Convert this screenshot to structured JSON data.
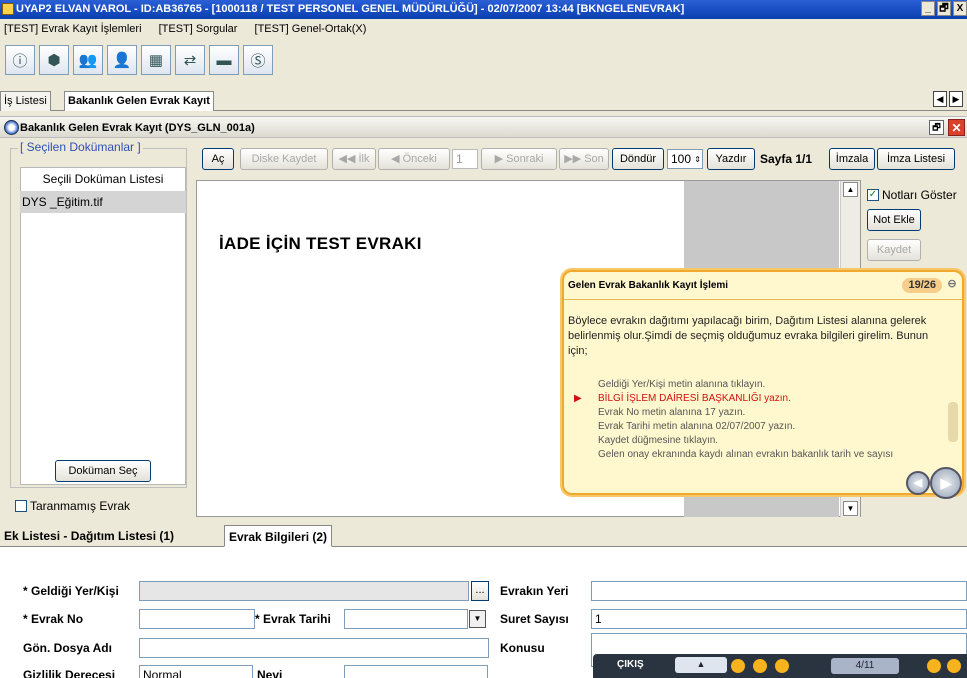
{
  "window": {
    "title": "UYAP2  ELVAN VAROL - ID:AB36765 - [1000118 / TEST PERSONEL GENEL MÜDÜRLÜĞÜ] - 02/07/2007 13:44 [BKNGELENEVRAK]",
    "controls": [
      "_",
      "🗗",
      "X"
    ]
  },
  "menu": [
    "[TEST] Evrak Kayıt İşlemleri",
    "[TEST] Sorgular",
    "[TEST] Genel-Ortak(X)"
  ],
  "tabs": [
    "İş Listesi",
    "Bakanlık Gelen Evrak Kayıt"
  ],
  "form_title": "Bakanlık Gelen Evrak Kayıt (DYS_GLN_001a)",
  "left_panel": {
    "group_title": "[ Seçilen Dokümanlar ]",
    "list_header": "Seçili Doküman Listesi",
    "items": [
      "DYS _Eğitim.tif"
    ],
    "select_button": "Doküman Seç",
    "unscanned_label": "Taranmamış Evrak"
  },
  "viewer_toolbar": {
    "open": "Aç",
    "save_disk": "Diske Kaydet",
    "first": "İlk",
    "prev": "Önceki",
    "page_input": "1",
    "next": "Sonraki",
    "last": "Son",
    "rotate": "Döndür",
    "zoom": "100",
    "print": "Yazdır",
    "page_info": "Sayfa 1/1",
    "sign": "İmzala",
    "sign_list": "İmza Listesi"
  },
  "document": {
    "text": "İADE İÇİN TEST EVRAKI"
  },
  "notes": {
    "show_label": "Notları Göster",
    "add_button": "Not Ekle",
    "save_button": "Kaydet"
  },
  "guide_popup": {
    "title": "Gelen Evrak Bakanlık Kayıt İşlemi",
    "counter": "19/26",
    "body": "Böylece evrakın dağıtımı yapılacağı birim, Dağıtım Listesi alanına gelerek belirlenmiş olur.Şimdi de seçmiş olduğumuz evraka bilgileri girelim. Bunun için;",
    "steps": [
      "Geldiği Yer/Kişi metin alanına tıklayın.",
      "BİLGİ İŞLEM DAİRESİ BAŞKANLIĞI yazın.",
      "Evrak No metin alanına 17 yazın.",
      "Evrak Tarihi metin alanına 02/07/2007 yazın.",
      "Kaydet düğmesine tıklayın.",
      "Gelen onay ekranında kaydı alınan evrakın bakanlık tarih ve sayısı"
    ],
    "current_step": 1
  },
  "bottom_tabs": [
    "Ek Listesi - Dağıtım Listesi (1)",
    "Evrak Bilgileri (2)"
  ],
  "fields": {
    "geldigi_label": "* Geldiği Yer/Kişi",
    "evrak_no_label": "* Evrak No",
    "evrak_tarihi_label": "* Evrak Tarihi",
    "gon_dosya_label": "Gön. Dosya Adı",
    "gizlilik_label": "Gizlilik Derecesi",
    "gizlilik_value": "Normal",
    "nevi_label": "Nevi",
    "evrak_yeri_label": "Evrakın Yeri",
    "suret_label": "Suret Sayısı",
    "suret_value": "1",
    "konusu_label": "Konusu",
    "browse": "..."
  },
  "bottom_bar": {
    "exit": "ÇIKIŞ",
    "progress": "4/11"
  }
}
